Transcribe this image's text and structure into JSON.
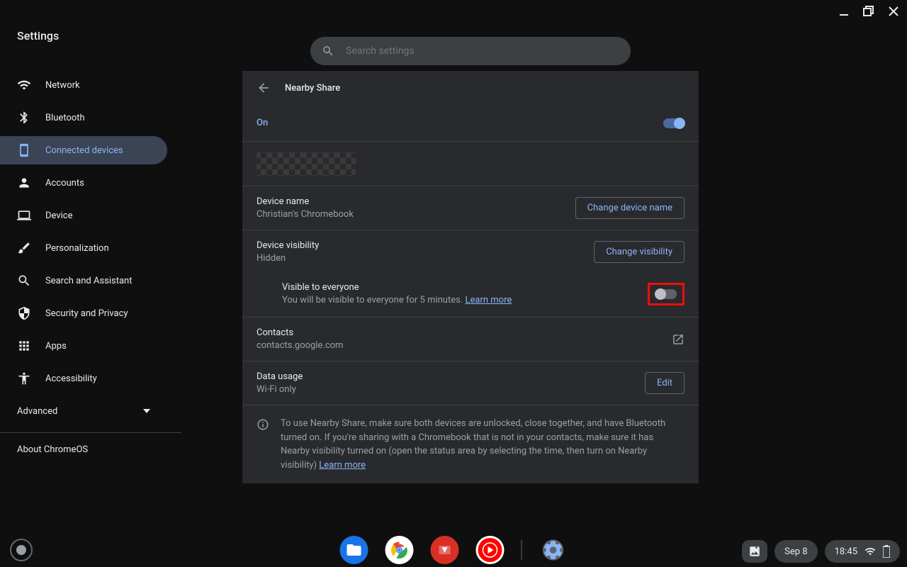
{
  "window": {
    "title": "Settings"
  },
  "search": {
    "placeholder": "Search settings"
  },
  "sidebar": {
    "items": [
      {
        "label": "Network"
      },
      {
        "label": "Bluetooth"
      },
      {
        "label": "Connected devices"
      },
      {
        "label": "Accounts"
      },
      {
        "label": "Device"
      },
      {
        "label": "Personalization"
      },
      {
        "label": "Search and Assistant"
      },
      {
        "label": "Security and Privacy"
      },
      {
        "label": "Apps"
      },
      {
        "label": "Accessibility"
      }
    ],
    "advanced_label": "Advanced",
    "about_label": "About ChromeOS"
  },
  "main": {
    "title": "Nearby Share",
    "on_label": "On",
    "device_name": {
      "label": "Device name",
      "value": "Christian's Chromebook",
      "button": "Change device name"
    },
    "visibility": {
      "label": "Device visibility",
      "value": "Hidden",
      "button": "Change visibility"
    },
    "visible_everyone": {
      "label": "Visible to everyone",
      "desc_prefix": "You will be visible to everyone for 5 minutes. ",
      "learn_more": "Learn more"
    },
    "contacts": {
      "label": "Contacts",
      "value": "contacts.google.com"
    },
    "data_usage": {
      "label": "Data usage",
      "value": "Wi-Fi only",
      "button": "Edit"
    },
    "info": {
      "text": "To use Nearby Share, make sure both devices are unlocked, close together, and have Bluetooth turned on. If you're sharing with a Chromebook that is not in your contacts, make sure it has Nearby visibility turned on (open the status area by selecting the time, then turn on Nearby visibility) ",
      "learn_more": "Learn more"
    }
  },
  "shelf": {
    "date": "Sep 8",
    "time": "18:45"
  }
}
